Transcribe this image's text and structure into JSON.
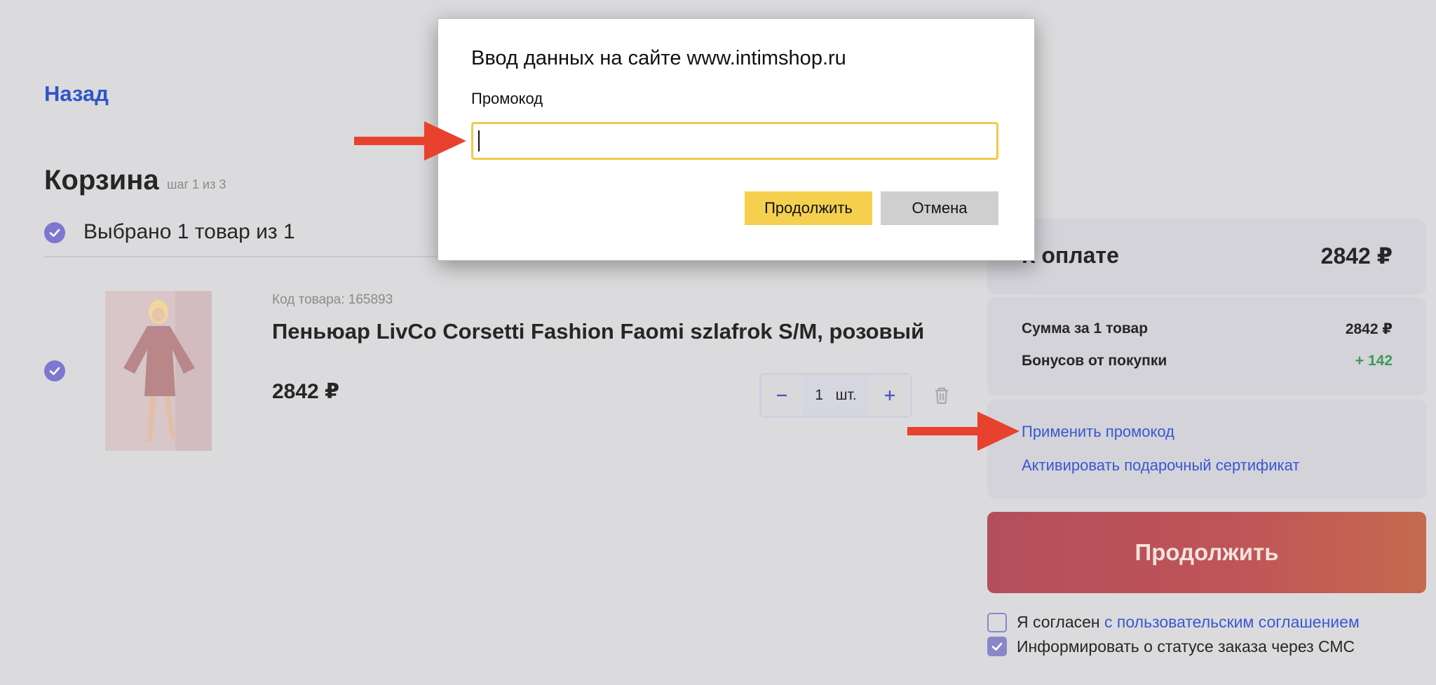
{
  "header": {
    "back_label": "Назад"
  },
  "cart": {
    "title": "Корзина",
    "step": "шаг 1 из 3",
    "select_all_label": "Выбрано 1 товар из 1"
  },
  "product": {
    "code": "Код товара: 165893",
    "name": "Пеньюар LivCo Corsetti Fashion Faomi szlafrok S/M, розовый",
    "price": "2842 ₽",
    "quantity": "1",
    "unit": "шт."
  },
  "summary": {
    "pay_label": "К оплате",
    "pay_value": "2842 ₽",
    "sum_label": "Сумма за 1 товар",
    "sum_value": "2842 ₽",
    "bonus_label": "Бонусов от покупки",
    "bonus_value": "+ 142",
    "promo_link": "Применить промокод",
    "certificate_link": "Активировать подарочный сертификат",
    "continue_label": "Продолжить"
  },
  "agreements": {
    "agree_prefix": "Я согласен ",
    "agree_link": "с пользовательским соглашением",
    "sms_label": "Информировать о статусе заказа через СМС"
  },
  "dialog": {
    "title": "Ввод данных на сайте www.intimshop.ru",
    "field_label": "Промокод",
    "input_value": "",
    "ok_label": "Продолжить",
    "cancel_label": "Отмена"
  },
  "colors": {
    "accent_blue": "#3a58d0",
    "checkbox_purple": "#7c77cf",
    "continue_gradient_start": "#b34f5c",
    "dialog_ok_yellow": "#f5d04e",
    "annotation_red": "#e8412d"
  }
}
